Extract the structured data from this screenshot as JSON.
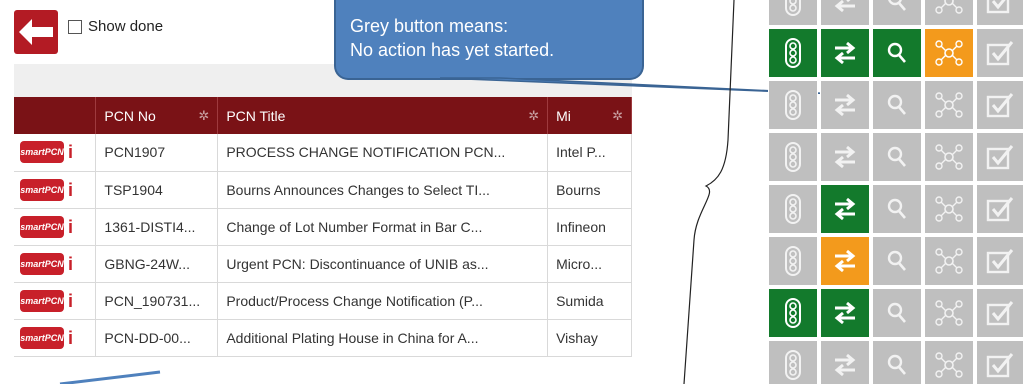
{
  "controls": {
    "show_done_label": "Show done"
  },
  "callout": {
    "line1": "Grey button means:",
    "line2": "No action has yet started."
  },
  "table": {
    "headers": [
      "PCN No",
      "PCN Title",
      "Mi"
    ],
    "rows": [
      {
        "pcn_no": "PCN1907",
        "title": "PROCESS CHANGE NOTIFICATION PCN...",
        "mfr": "Intel P..."
      },
      {
        "pcn_no": "TSP1904",
        "title": "Bourns Announces Changes to Select TI...",
        "mfr": "Bourns"
      },
      {
        "pcn_no": "1361-DISTI4...",
        "title": "Change of Lot Number Format in Bar C...",
        "mfr": "Infineon"
      },
      {
        "pcn_no": "GBNG-24W...",
        "title": "Urgent PCN: Discontinuance of UNIB as...",
        "mfr": "Micro..."
      },
      {
        "pcn_no": "PCN_190731...",
        "title": "Product/Process Change Notification (P...",
        "mfr": "Sumida"
      },
      {
        "pcn_no": "PCN-DD-00...",
        "title": "Additional Plating House in China for A...",
        "mfr": "Vishay"
      }
    ],
    "logo_text": "smartPCN",
    "info_glyph": "i"
  },
  "status_grid": {
    "icons": [
      "traffic-light-icon",
      "exchange-arrows-icon",
      "magnifier-icon",
      "network-icon",
      "checkbox-icon"
    ],
    "colors": {
      "grey": "#bfbfbf",
      "green": "#137a2c",
      "orange": "#f39a1c"
    },
    "rows": [
      [
        "grey",
        "grey",
        "grey",
        "grey",
        "grey"
      ],
      [
        "green",
        "green",
        "green",
        "orange",
        "grey"
      ],
      [
        "grey",
        "grey",
        "grey",
        "grey",
        "grey"
      ],
      [
        "grey",
        "grey",
        "grey",
        "grey",
        "grey"
      ],
      [
        "grey",
        "green",
        "grey",
        "grey",
        "grey"
      ],
      [
        "grey",
        "orange",
        "grey",
        "grey",
        "grey"
      ],
      [
        "green",
        "green",
        "grey",
        "grey",
        "grey"
      ],
      [
        "grey",
        "grey",
        "grey",
        "grey",
        "grey"
      ]
    ]
  }
}
